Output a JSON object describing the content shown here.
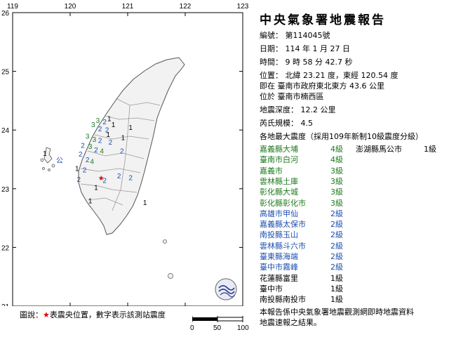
{
  "report": {
    "title": "中央氣象署地震報告",
    "number_label": "編號：",
    "number": "第114045號",
    "date_label": "日期：",
    "date": "114 年 1 月 27 日",
    "time_label": "時間：",
    "time": "9 時 58 分 42.7 秒",
    "location_label": "位置：",
    "location": "北緯 23.21 度，東經 120.54 度",
    "location_ref": "即在 臺南市政府東北東方 43.6 公里",
    "location_in": "位於 臺南市楠西區",
    "depth_label": "地震深度：",
    "depth": "12.2 公里",
    "magnitude_label": "芮氏規模：",
    "magnitude": "4.5",
    "intensity_header": "各地最大震度（採用109年新制10級震度分級）",
    "note_line1": "本報告係中央氣象署地震觀測網即時地震資料",
    "note_line2": "地震速報之結果。"
  },
  "intensities": [
    {
      "name": "嘉義縣大埔",
      "level": "4級",
      "color": "#1e7a1e"
    },
    {
      "name": "臺南市白河",
      "level": "4級",
      "color": "#1e7a1e"
    },
    {
      "name": "嘉義市",
      "level": "3級",
      "color": "#1e7a1e"
    },
    {
      "name": "雲林縣土庫",
      "level": "3級",
      "color": "#1e7a1e"
    },
    {
      "name": "彰化縣大城",
      "level": "3級",
      "color": "#1e7a1e"
    },
    {
      "name": "彰化縣彰化市",
      "level": "3級",
      "color": "#1e7a1e"
    },
    {
      "name": "高雄市甲仙",
      "level": "2級",
      "color": "#1c4fb0"
    },
    {
      "name": "嘉義縣太保市",
      "level": "2級",
      "color": "#1c4fb0"
    },
    {
      "name": "南投縣玉山",
      "level": "2級",
      "color": "#1c4fb0"
    },
    {
      "name": "雲林縣斗六市",
      "level": "2級",
      "color": "#1c4fb0"
    },
    {
      "name": "臺東縣海端",
      "level": "2級",
      "color": "#1c4fb0"
    },
    {
      "name": "臺中市霧峰",
      "level": "2級",
      "color": "#1c4fb0"
    },
    {
      "name": "花蓮縣富里",
      "level": "1級",
      "color": "#000000"
    },
    {
      "name": "臺中市",
      "level": "1級",
      "color": "#000000"
    },
    {
      "name": "南投縣南投市",
      "level": "1級",
      "color": "#000000"
    }
  ],
  "intensities_col2": [
    {
      "name": "澎湖縣馬公市",
      "level": "1級",
      "color": "#000000"
    }
  ],
  "map": {
    "lon_ticks": [
      "119",
      "120",
      "121",
      "122",
      "123"
    ],
    "lat_ticks": [
      "26",
      "25",
      "24",
      "23",
      "22",
      "21"
    ],
    "epicenter_color": "#e00000",
    "stations": [
      {
        "t": "1",
        "lon": 120.68,
        "lat": 24.15,
        "c": "#000"
      },
      {
        "t": "1",
        "lon": 120.75,
        "lat": 24.05,
        "c": "#000"
      },
      {
        "t": "1",
        "lon": 121.05,
        "lat": 24.0,
        "c": "#000"
      },
      {
        "t": "2",
        "lon": 120.6,
        "lat": 24.1,
        "c": "#1c4fb0"
      },
      {
        "t": "3",
        "lon": 120.4,
        "lat": 24.05,
        "c": "#1e7a1e"
      },
      {
        "t": "3",
        "lon": 120.48,
        "lat": 24.12,
        "c": "#1e7a1e"
      },
      {
        "t": "2",
        "lon": 120.52,
        "lat": 23.98,
        "c": "#1c4fb0"
      },
      {
        "t": "2",
        "lon": 120.64,
        "lat": 23.96,
        "c": "#1c4fb0"
      },
      {
        "t": "1",
        "lon": 120.66,
        "lat": 23.88,
        "c": "#000"
      },
      {
        "t": "1",
        "lon": 120.92,
        "lat": 23.83,
        "c": "#000"
      },
      {
        "t": "3",
        "lon": 120.3,
        "lat": 23.85,
        "c": "#1e7a1e"
      },
      {
        "t": "3",
        "lon": 120.42,
        "lat": 23.8,
        "c": "#1e7a1e"
      },
      {
        "t": "2",
        "lon": 120.52,
        "lat": 23.78,
        "c": "#1c4fb0"
      },
      {
        "t": "2",
        "lon": 120.7,
        "lat": 23.75,
        "c": "#1c4fb0"
      },
      {
        "t": "2",
        "lon": 120.22,
        "lat": 23.7,
        "c": "#1c4fb0"
      },
      {
        "t": "3",
        "lon": 120.35,
        "lat": 23.68,
        "c": "#1e7a1e"
      },
      {
        "t": "2",
        "lon": 120.45,
        "lat": 23.62,
        "c": "#1c4fb0"
      },
      {
        "t": "4",
        "lon": 120.55,
        "lat": 23.6,
        "c": "#1e7a1e"
      },
      {
        "t": "2",
        "lon": 120.9,
        "lat": 23.6,
        "c": "#1c4fb0"
      },
      {
        "t": "2",
        "lon": 120.18,
        "lat": 23.55,
        "c": "#1c4fb0"
      },
      {
        "t": "4",
        "lon": 120.38,
        "lat": 23.42,
        "c": "#1e7a1e"
      },
      {
        "t": "2",
        "lon": 120.3,
        "lat": 23.45,
        "c": "#1c4fb0"
      },
      {
        "t": "1",
        "lon": 120.12,
        "lat": 23.3,
        "c": "#000"
      },
      {
        "t": "2",
        "lon": 120.25,
        "lat": 23.28,
        "c": "#1c4fb0"
      },
      {
        "t": "2",
        "lon": 120.15,
        "lat": 23.12,
        "c": "#1c4fb0"
      },
      {
        "t": "2",
        "lon": 120.6,
        "lat": 23.1,
        "c": "#1c4fb0"
      },
      {
        "t": "2",
        "lon": 120.85,
        "lat": 23.18,
        "c": "#1c4fb0"
      },
      {
        "t": "2",
        "lon": 121.05,
        "lat": 23.15,
        "c": "#1c4fb0"
      },
      {
        "t": "1",
        "lon": 120.45,
        "lat": 22.98,
        "c": "#000"
      },
      {
        "t": "1",
        "lon": 120.35,
        "lat": 22.75,
        "c": "#000"
      },
      {
        "t": "1",
        "lon": 121.3,
        "lat": 22.72,
        "c": "#000"
      },
      {
        "t": "1",
        "lon": 119.56,
        "lat": 23.56,
        "c": "#000"
      }
    ]
  },
  "footer": {
    "legend_prefix": "圖說：",
    "legend_star": "★",
    "legend_text": "表震央位置，數字表示該測站震度",
    "scale_ticks": [
      "0",
      "50",
      "100"
    ]
  }
}
